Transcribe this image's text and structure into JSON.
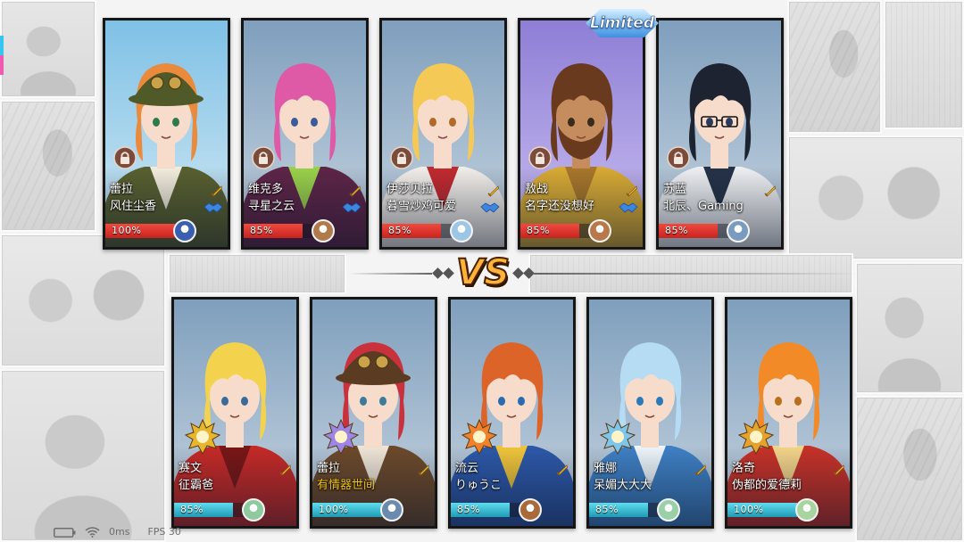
{
  "enemy_team": [
    {
      "hero": "蕾拉",
      "player": "风住尘香",
      "progress": "100%"
    },
    {
      "hero": "维克多",
      "player": "寻星之云",
      "progress": "85%"
    },
    {
      "hero": "伊莎贝拉",
      "player": "暮雪炒鸡可爱",
      "progress": "85%"
    },
    {
      "hero": "敖战",
      "player": "名字还没想好",
      "progress": "85%",
      "badge": "Limited"
    },
    {
      "hero": "苏蓝",
      "player": "北辰、Gaming",
      "progress": "85%"
    }
  ],
  "ally_team": [
    {
      "hero": "赛文",
      "player": "征霸爸",
      "progress": "85%"
    },
    {
      "hero": "蕾拉",
      "player": "有情器世间",
      "progress": "100%"
    },
    {
      "hero": "流云",
      "player": "りゅうこ",
      "progress": "85%"
    },
    {
      "hero": "雅娜",
      "player": "呆媚大大大",
      "progress": "85%"
    },
    {
      "hero": "洛奇",
      "player": "伪都的爱德莉",
      "progress": "100%"
    }
  ],
  "vs_label": "VS",
  "status_bar": {
    "ping": "0ms",
    "fps": "FPS 30"
  },
  "icons": {
    "locked_slot": "lock-icon",
    "rank": "sword-icon",
    "spell": "handshake-icon",
    "emblem": "crest-icon",
    "battery": "battery-icon",
    "network": "wifi-icon"
  },
  "colors": {
    "enemy_progress": "#c9231f",
    "ally_progress": "#1f9bb5",
    "self_player_name": "#f5c518",
    "limited_badge": "#3d8fe0",
    "vs_emblem": "#ffb23a"
  }
}
